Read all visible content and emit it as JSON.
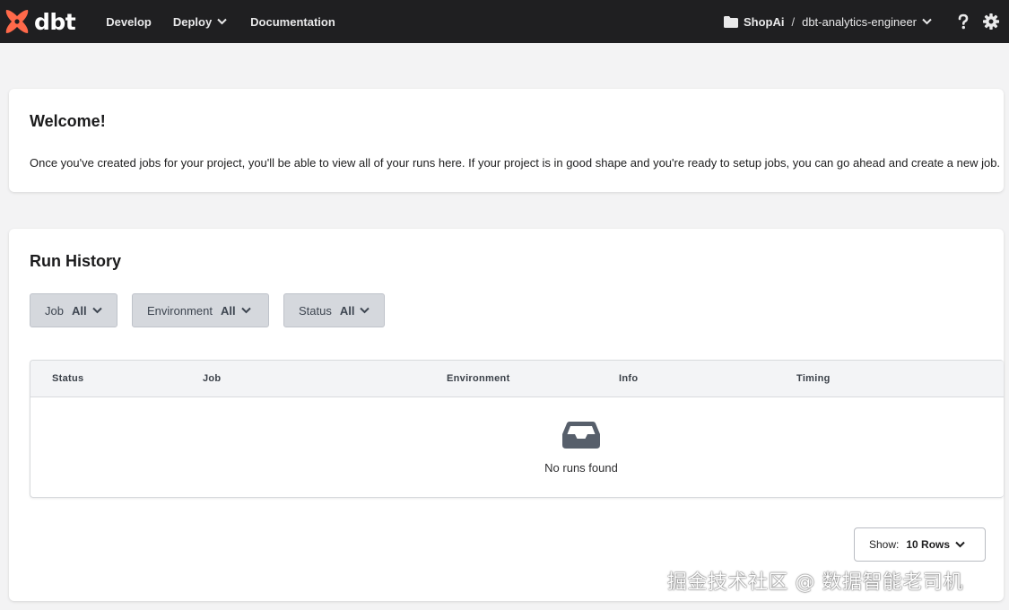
{
  "nav": {
    "brand": "dbt",
    "items": [
      {
        "label": "Develop"
      },
      {
        "label": "Deploy"
      },
      {
        "label": "Documentation"
      }
    ],
    "project": "ShopAi",
    "separator": "/",
    "branch": "dbt-analytics-engineer",
    "icons": [
      "folder-icon",
      "help-icon",
      "gear-icon"
    ]
  },
  "welcome": {
    "title": "Welcome!",
    "text": "Once you've created jobs for your project, you'll be able to view all of your runs here. If your project is in good shape and you're ready to setup jobs, you can go ahead and create a new job."
  },
  "run_history": {
    "title": "Run History",
    "filters": [
      {
        "label": "Job",
        "value": "All"
      },
      {
        "label": "Environment",
        "value": "All"
      },
      {
        "label": "Status",
        "value": "All"
      }
    ],
    "columns": [
      "Status",
      "Job",
      "Environment",
      "Info",
      "Timing"
    ],
    "rows": [],
    "empty_message": "No runs found",
    "show_label": "Show:",
    "show_value": "10 Rows"
  },
  "watermark": "掘金技术社区 @ 数据智能老司机",
  "colors": {
    "brand": "#ff694a",
    "topbar": "#1f1f21",
    "filter_bg": "#d5d8dd"
  }
}
